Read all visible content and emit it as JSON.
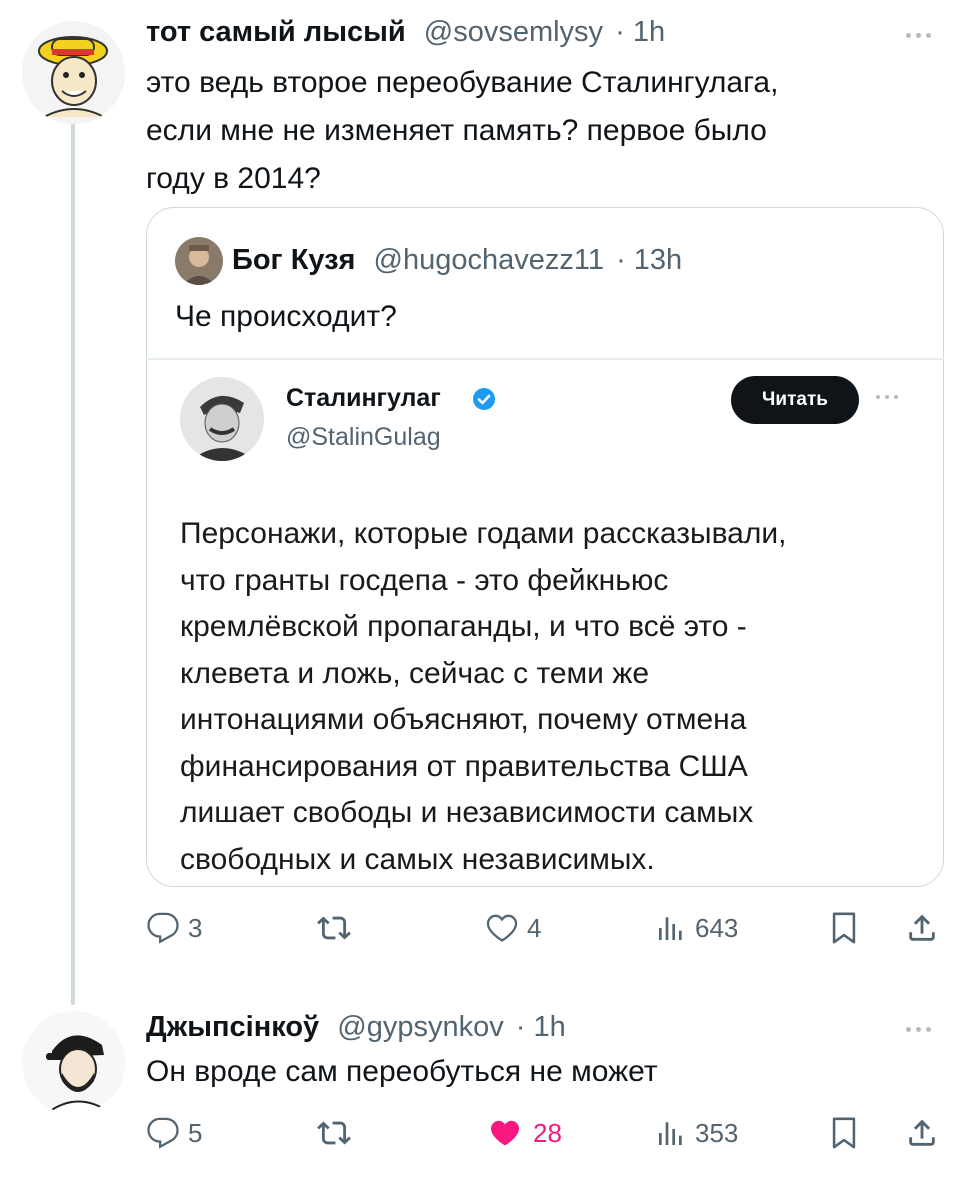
{
  "tweet1": {
    "display_name": "тот самый лысый",
    "handle": "@sovsemlysy",
    "time": "· 1h",
    "text_lines": [
      "это ведь второе переобувание Сталингулага,",
      "если мне не изменяет память? первое было",
      "году в 2014?"
    ],
    "avatar_icon": "cartoon-straw-hat-avatar-icon"
  },
  "quote": {
    "display_name": "Бог Кузя",
    "handle": "@hugochavezz11",
    "time": "· 13h",
    "text": "Че происходит?",
    "avatar_icon": "person-photo-avatar-icon"
  },
  "embed": {
    "display_name": "Сталингулаг",
    "handle": "@StalinGulag",
    "follow_label": "Читать",
    "verified_color": "#1d9bf0",
    "text_lines": [
      "Персонажи, которые годами рассказывали,",
      "что гранты госдепа - это фейкньюс",
      "кремлёвской пропаганды, и что всё это -",
      "клевета и ложь, сейчас с теми же",
      "интонациями объясняют, почему отмена",
      "финансирования от правительства США",
      "лишает свободы и независимости самых",
      "свободных и самых независимых."
    ]
  },
  "tweet1_actions": {
    "replies": "3",
    "reposts": "",
    "likes": "4",
    "views": "643"
  },
  "tweet2": {
    "display_name": "Джыпсінкоў",
    "handle": "@gypsynkov",
    "time": "· 1h",
    "text": "Он вроде сам переобуться не может",
    "avatar_icon": "bearded-man-cap-avatar-icon"
  },
  "tweet2_actions": {
    "replies": "5",
    "reposts": "",
    "likes": "28",
    "views": "353",
    "liked_color": "#f91880"
  }
}
